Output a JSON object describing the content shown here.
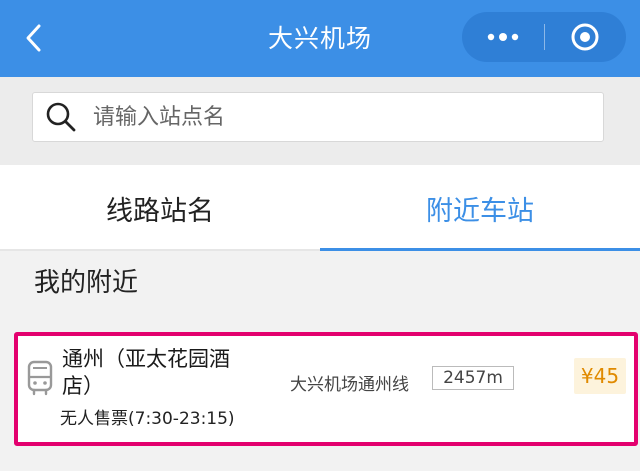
{
  "nav": {
    "title": "大兴机场",
    "back_icon": "chevron-left-icon",
    "more_icon": "more-dots-icon",
    "close_icon": "target-circle-icon",
    "bg_color": "#3c8fe6"
  },
  "search": {
    "placeholder": "请输入站点名",
    "value": ""
  },
  "tabs": [
    {
      "label": "线路站名",
      "active": false
    },
    {
      "label": "附近车站",
      "active": true
    }
  ],
  "nearby": {
    "title": "我的附近",
    "stations": [
      {
        "name": "通州（亚太花园酒店）",
        "ticket": "无人售票(7:30-23:15)",
        "line": "大兴机场通州线",
        "distance": "2457m",
        "price": "¥45",
        "icon": "bus-icon"
      }
    ]
  },
  "colors": {
    "accent": "#3c8fe6",
    "highlight_border": "#e3006e",
    "price": "#e08a00"
  }
}
